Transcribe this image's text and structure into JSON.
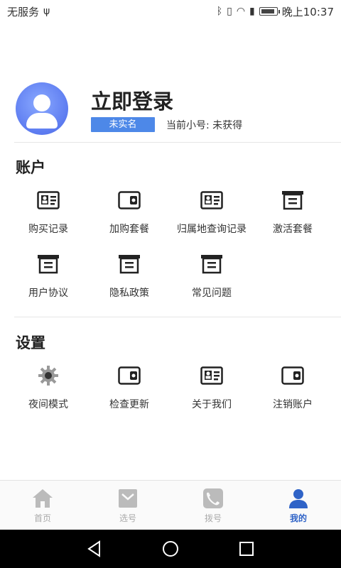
{
  "status_bar": {
    "carrier": "无服务",
    "time": "晚上10:37"
  },
  "profile": {
    "login_title": "立即登录",
    "verify_badge": "未实名",
    "number_label": "当前小号: 未获得"
  },
  "sections": {
    "account": {
      "title": "账户",
      "items": [
        {
          "label": "购买记录",
          "icon": "id-card-icon"
        },
        {
          "label": "加购套餐",
          "icon": "wallet-icon"
        },
        {
          "label": "归属地查询记录",
          "icon": "id-card-icon"
        },
        {
          "label": "激活套餐",
          "icon": "archive-box-icon"
        },
        {
          "label": "用户协议",
          "icon": "archive-box-icon"
        },
        {
          "label": "隐私政策",
          "icon": "archive-box-icon"
        },
        {
          "label": "常见问题",
          "icon": "archive-box-icon"
        }
      ]
    },
    "settings": {
      "title": "设置",
      "items": [
        {
          "label": "夜间模式",
          "icon": "gear-icon"
        },
        {
          "label": "检查更新",
          "icon": "wallet-icon"
        },
        {
          "label": "关于我们",
          "icon": "id-card-icon"
        },
        {
          "label": "注销账户",
          "icon": "wallet-icon"
        }
      ]
    }
  },
  "bottom_nav": {
    "tabs": [
      {
        "label": "首页",
        "icon": "home-icon",
        "active": false
      },
      {
        "label": "选号",
        "icon": "inbox-icon",
        "active": false
      },
      {
        "label": "拨号",
        "icon": "phone-icon",
        "active": false
      },
      {
        "label": "我的",
        "icon": "user-icon",
        "active": true
      }
    ]
  },
  "colors": {
    "accent": "#2f63c7",
    "badge": "#4d88e8",
    "avatar": "#5c7bf0",
    "icon_dark": "#222222",
    "inactive_tab": "#aaaaaa"
  }
}
